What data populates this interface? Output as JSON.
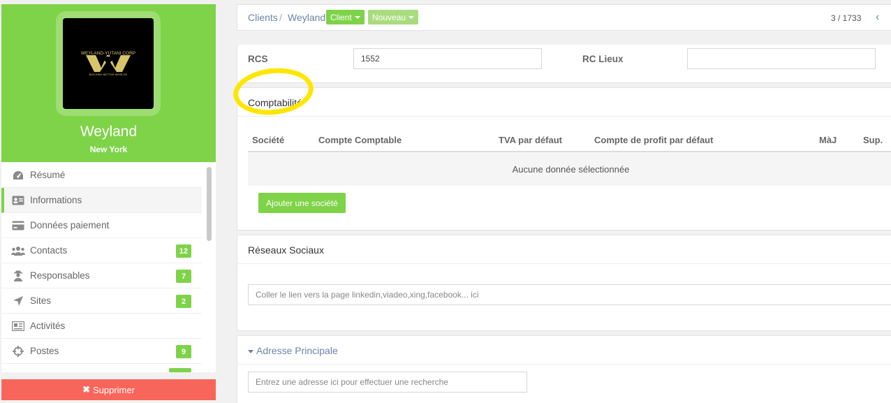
{
  "profile": {
    "name": "Weyland",
    "city": "New York",
    "logo_top_text": "WEYLAND-YUTANI CORP",
    "logo_bottom_text": "BUILDING BETTER WORLDS"
  },
  "menu": {
    "items": [
      {
        "label": "Résumé",
        "icon": "gauge-icon",
        "badge": null
      },
      {
        "label": "Informations",
        "icon": "id-card-icon",
        "badge": null,
        "active": true
      },
      {
        "label": "Données paiement",
        "icon": "credit-card-icon",
        "badge": null
      },
      {
        "label": "Contacts",
        "icon": "users-icon",
        "badge": "12"
      },
      {
        "label": "Responsables",
        "icon": "user-secret-icon",
        "badge": "7"
      },
      {
        "label": "Sites",
        "icon": "location-arrow-icon",
        "badge": "2"
      },
      {
        "label": "Activités",
        "icon": "newspaper-icon",
        "badge": null
      },
      {
        "label": "Postes",
        "icon": "crosshairs-icon",
        "badge": "9"
      }
    ],
    "delete_label": "Supprimer"
  },
  "topbar": {
    "crumb_clients": "Clients",
    "crumb_sep": "/",
    "crumb_current": "Weyland",
    "client_pill": "Client",
    "nouveau_pill": "Nouveau",
    "counter": "3 / 1733",
    "prev_icon": "‹"
  },
  "registry": {
    "rcs_label": "RCS",
    "rcs_value": "1552",
    "rc_lieux_label": "RC Lieux",
    "rc_lieux_value": ""
  },
  "comptabilite": {
    "title": "Comptabilité",
    "columns": [
      "Société",
      "Compte Comptable",
      "TVA par défaut",
      "Compte de profit par défaut",
      "MàJ",
      "Sup."
    ],
    "empty_text": "Aucune donnée sélectionnée",
    "add_label": "Ajouter une société"
  },
  "reseaux": {
    "title": "Réseaux Sociaux",
    "placeholder": "Coller le lien vers la page linkedin,viadeo,xing,facebook... ici"
  },
  "adresse": {
    "title": "Adresse Principale",
    "placeholder": "Entrez une adresse ici pour effectuer une recherche"
  },
  "colors": {
    "green": "#7ed348",
    "red": "#f8655b",
    "link": "#6a85a8",
    "highlight": "#ffe600"
  }
}
